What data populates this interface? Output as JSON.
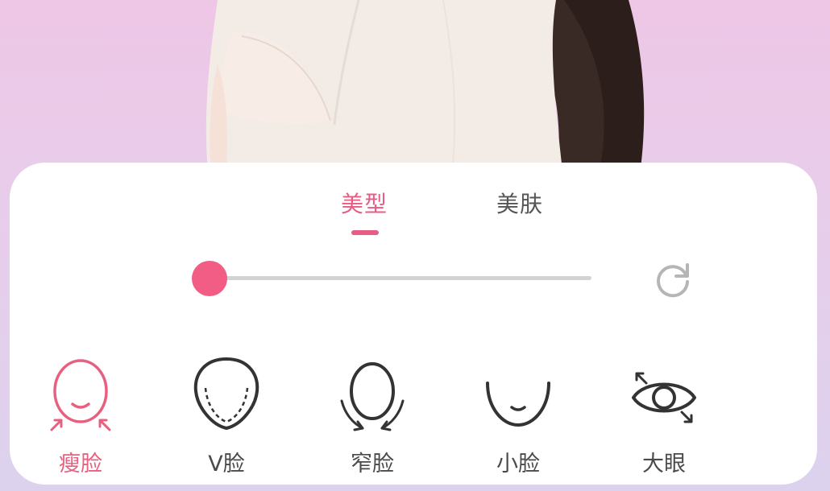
{
  "tabs": [
    {
      "label": "美型",
      "active": true
    },
    {
      "label": "美肤",
      "active": false
    }
  ],
  "slider": {
    "value": 0,
    "accent": "#f25d85"
  },
  "reset_icon": "refresh-icon",
  "tools": [
    {
      "label": "瘦脸",
      "icon": "slim-face-icon",
      "active": true
    },
    {
      "label": "V脸",
      "icon": "v-face-icon",
      "active": false
    },
    {
      "label": "窄脸",
      "icon": "narrow-face-icon",
      "active": false
    },
    {
      "label": "小脸",
      "icon": "small-face-icon",
      "active": false
    },
    {
      "label": "大眼",
      "icon": "big-eye-icon",
      "active": false
    }
  ],
  "colors": {
    "accent": "#e85c84",
    "text": "#4a4a4a",
    "track": "#d3d3d3"
  }
}
